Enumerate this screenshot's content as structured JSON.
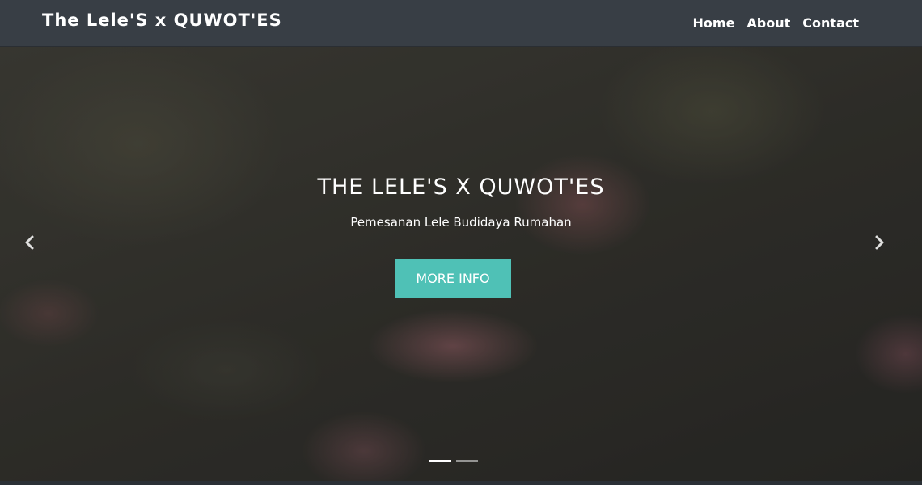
{
  "navbar": {
    "brand": "The Lele'S x QUWOT'ES",
    "links": [
      "Home",
      "About",
      "Contact"
    ]
  },
  "hero": {
    "title": "THE LELE'S X QUWOT'ES",
    "subtitle": "Pemesanan Lele Budidaya Rumahan",
    "button_label": "MORE INFO",
    "slide_count": 2,
    "active_slide": 1
  },
  "colors": {
    "navbar_bg": "#383e45",
    "accent_button": "#4fc1b6",
    "text": "#ffffff"
  },
  "icons": {
    "prev": "chevron-left-icon",
    "next": "chevron-right-icon"
  }
}
